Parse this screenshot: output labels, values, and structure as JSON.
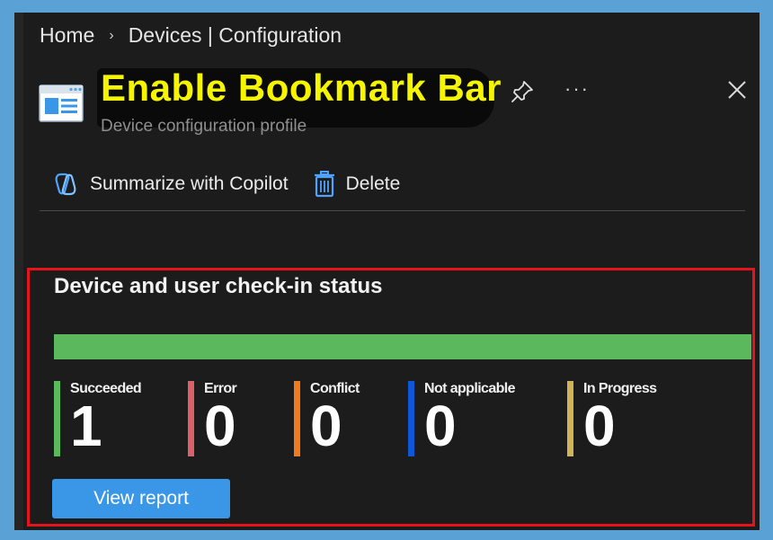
{
  "breadcrumb": {
    "home": "Home",
    "separator": "›",
    "current": "Devices | Configuration"
  },
  "header": {
    "title": "Enable Bookmark Bar",
    "subtitle": "Device configuration profile",
    "more_label": "···",
    "title_color": "#f5f500"
  },
  "toolbar": {
    "summarize_label": "Summarize with Copilot",
    "delete_label": "Delete"
  },
  "status": {
    "title": "Device and user check-in status",
    "progress_succeeded_fraction": 1.0,
    "items": [
      {
        "label": "Succeeded",
        "value": "1",
        "color": "#5bb85c"
      },
      {
        "label": "Error",
        "value": "0",
        "color": "#d9626a"
      },
      {
        "label": "Conflict",
        "value": "0",
        "color": "#f07a1f"
      },
      {
        "label": "Not applicable",
        "value": "0",
        "color": "#0e57d6"
      },
      {
        "label": "In Progress",
        "value": "0",
        "color": "#d1b35a"
      }
    ],
    "view_report_label": "View report"
  },
  "colors": {
    "accent": "#3a97e8",
    "highlight_border": "#e3141b",
    "background": "#1c1c1c"
  }
}
